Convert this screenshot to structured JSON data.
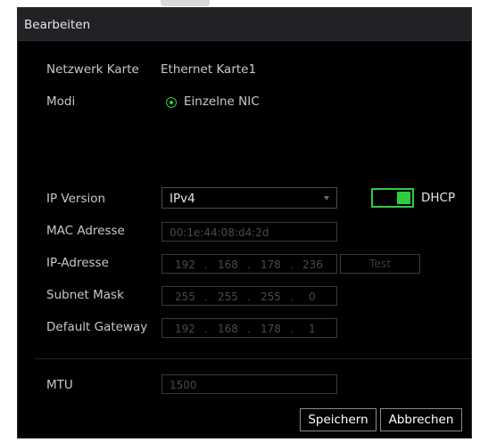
{
  "dialog": {
    "title": "Bearbeiten"
  },
  "network_card": {
    "label": "Netzwerk Karte",
    "value": "Ethernet Karte1"
  },
  "mode": {
    "label": "Modi",
    "option": "Einzelne NIC"
  },
  "ip_version": {
    "label": "IP Version",
    "value": "IPv4"
  },
  "dhcp": {
    "label": "DHCP",
    "enabled": true
  },
  "mac": {
    "label": "MAC Adresse",
    "value": "00:1e:44:08:d4:2d"
  },
  "ip_address": {
    "label": "IP-Adresse",
    "octets": [
      "192",
      "168",
      "178",
      "236"
    ],
    "test_label": "Test"
  },
  "subnet_mask": {
    "label": "Subnet Mask",
    "octets": [
      "255",
      "255",
      "255",
      "0"
    ]
  },
  "gateway": {
    "label": "Default Gateway",
    "octets": [
      "192",
      "168",
      "178",
      "1"
    ]
  },
  "mtu": {
    "label": "MTU",
    "value": "1500"
  },
  "buttons": {
    "save": "Speichern",
    "cancel": "Abbrechen"
  },
  "separator": ".",
  "colors": {
    "accent": "#2ecc40",
    "background": "#000000",
    "titlebar": "#202226"
  }
}
